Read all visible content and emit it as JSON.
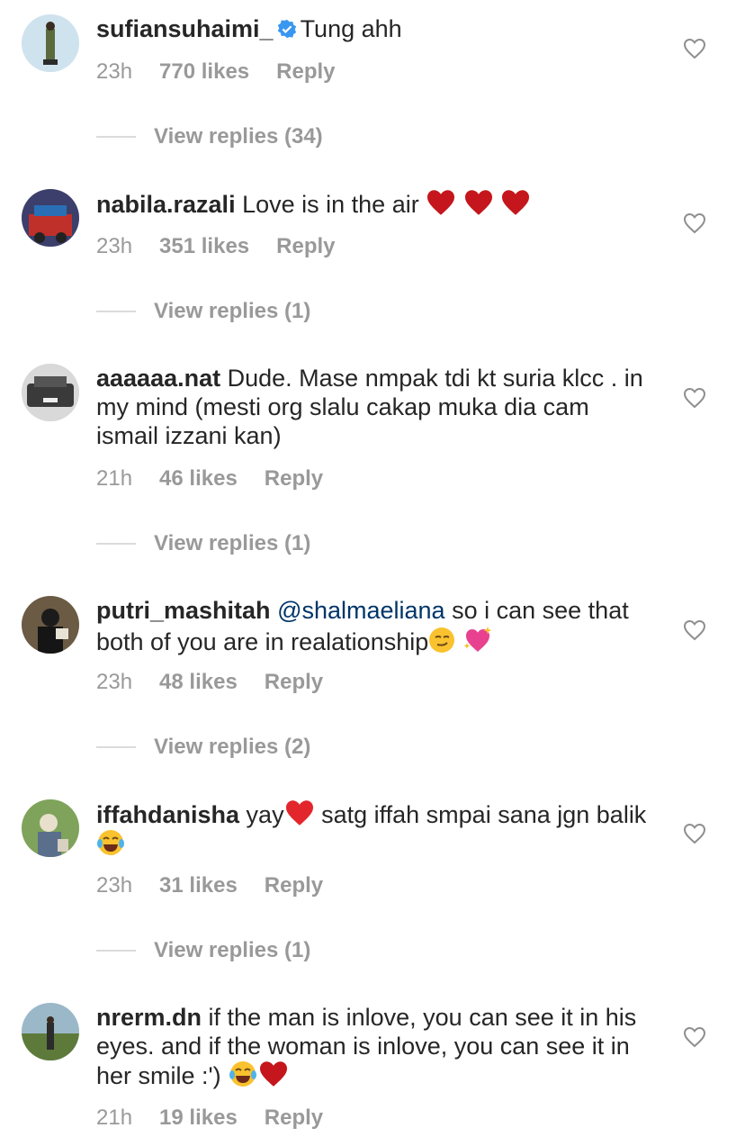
{
  "comments": [
    {
      "username": "sufiansuhaimi_",
      "verified": true,
      "text": "Tung ahh",
      "time": "23h",
      "likes": "770 likes",
      "reply": "Reply",
      "view_replies": "View replies (34)"
    },
    {
      "username": "nabila.razali",
      "text": "Love is in the air",
      "emojis": [
        "heart",
        "heart",
        "heart"
      ],
      "time": "23h",
      "likes": "351 likes",
      "reply": "Reply",
      "view_replies": "View replies (1)"
    },
    {
      "username": "aaaaaa.nat",
      "text": "Dude. Mase nmpak tdi kt suria klcc . in my mind (mesti org slalu cakap muka dia cam ismail izzani kan)",
      "time": "21h",
      "likes": "46 likes",
      "reply": "Reply",
      "view_replies": "View replies (1)"
    },
    {
      "username": "putri_mashitah",
      "mention": "@shalmaeliana",
      "text": "so i can see that both of you are in realationship",
      "emojis": [
        "smirk",
        "sparkling-heart"
      ],
      "time": "23h",
      "likes": "48 likes",
      "reply": "Reply",
      "view_replies": "View replies (2)"
    },
    {
      "username": "iffahdanisha",
      "text_a": "yay",
      "text_b": "satg iffah smpai sana jgn balik",
      "emojis": [
        "heart",
        "joy"
      ],
      "time": "23h",
      "likes": "31 likes",
      "reply": "Reply",
      "view_replies": "View replies (1)"
    },
    {
      "username": "nrerm.dn",
      "text": "if the man is inlove, you can see it in his eyes. and if the woman is inlove, you can see it in her smile :')",
      "emojis": [
        "joy",
        "heart"
      ],
      "time": "21h",
      "likes": "19 likes",
      "reply": "Reply"
    }
  ]
}
